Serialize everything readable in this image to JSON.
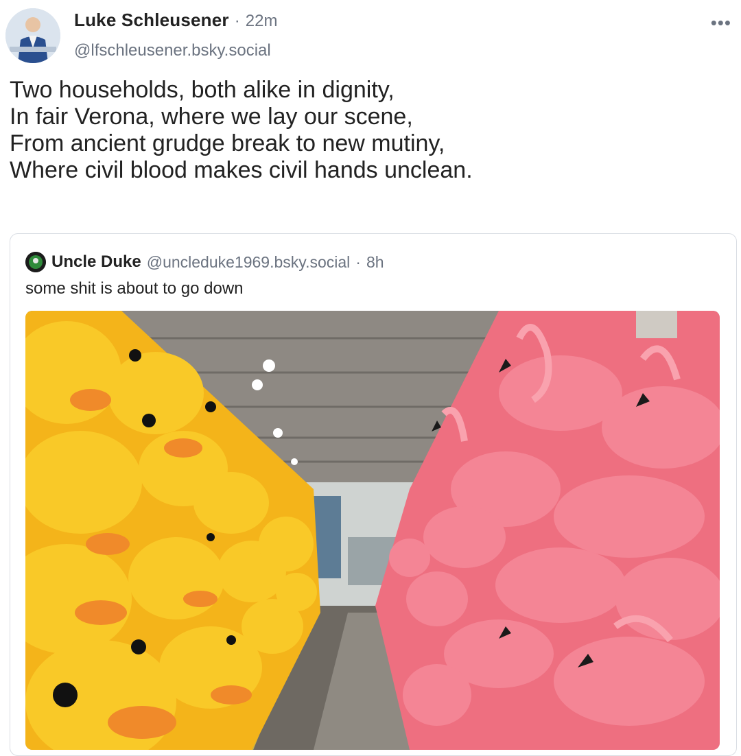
{
  "post": {
    "author": {
      "display_name": "Luke Schleusener",
      "handle": "@lfschleusener.bsky.social",
      "avatar_icon": "user-avatar"
    },
    "separator": "·",
    "time": "22m",
    "more_label": "•••",
    "text_lines": [
      "Two households, both alike in dignity,",
      "In fair Verona, where we lay our scene,",
      "From ancient grudge break to new mutiny,",
      "Where civil blood makes civil hands unclean."
    ]
  },
  "quote": {
    "author": {
      "display_name": "Uncle Duke",
      "handle": "@uncleduke1969.bsky.social",
      "avatar_icon": "user-avatar"
    },
    "separator": "·",
    "time": "8h",
    "text": "some shit is about to go down",
    "image": {
      "description_icon": "warehouse-photo",
      "colors": {
        "duck": "#f7c21e",
        "duck_beak": "#f08a2a",
        "flamingo": "#f27b8a",
        "ceiling": "#8b8680",
        "floor": "#6f6a63"
      }
    }
  }
}
